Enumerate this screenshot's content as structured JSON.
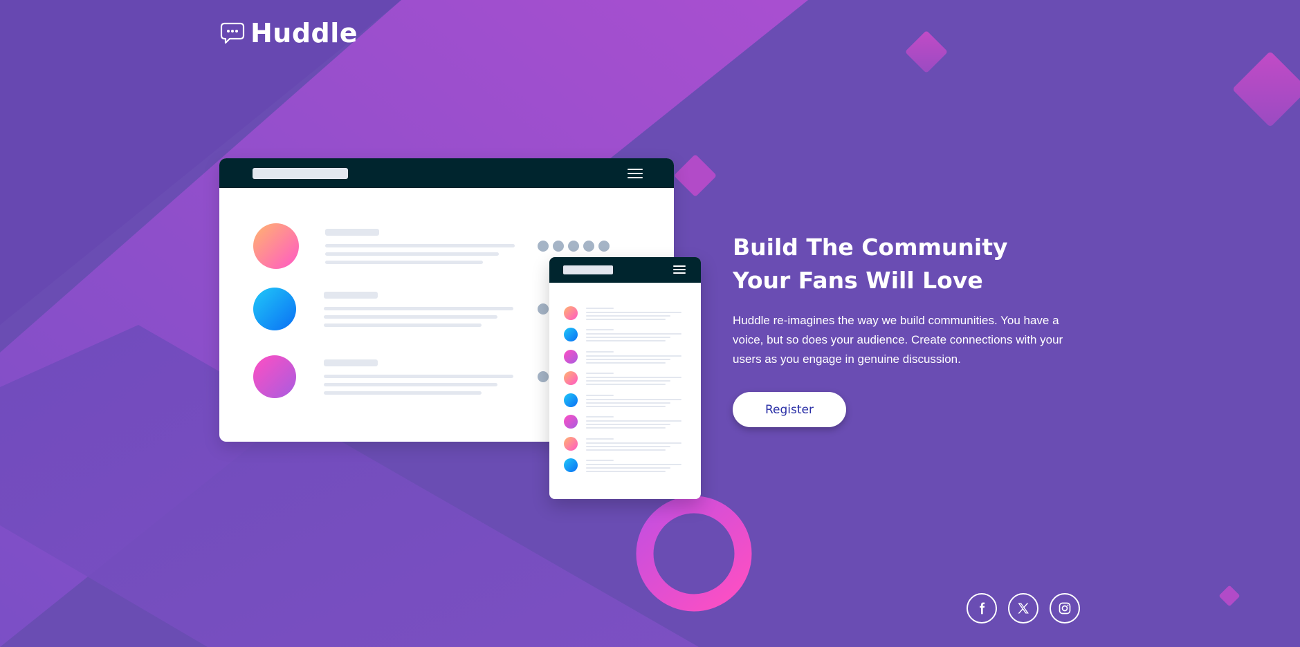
{
  "brand": {
    "name": "Huddle"
  },
  "hero": {
    "title": "Build The Community Your Fans Will Love",
    "description": "Huddle re-imagines the way we build communities. You have a voice, but so does your audience. Create connections with your users as you engage in genuine discussion.",
    "cta_label": "Register"
  },
  "social": [
    {
      "icon": "facebook-icon"
    },
    {
      "icon": "x-icon"
    },
    {
      "icon": "instagram-icon"
    }
  ],
  "colors": {
    "background": "#6a4db3",
    "mock_bar": "#00252e",
    "cta_text": "#2a2fa6",
    "accent_pink": "#f054c8"
  }
}
